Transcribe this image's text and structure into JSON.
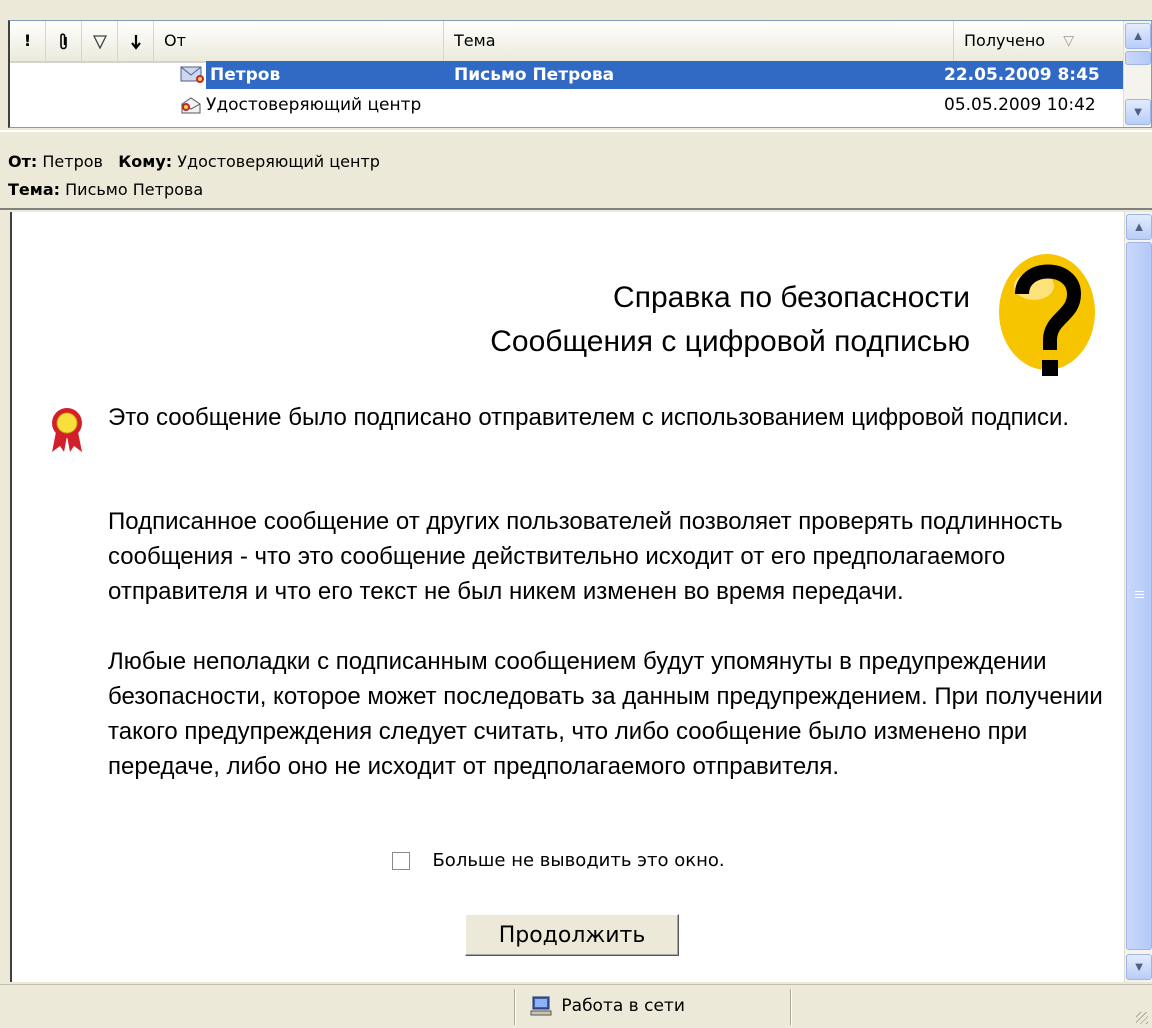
{
  "message_list": {
    "columns": {
      "importance_icon": "exclamation-icon",
      "attachment_icon": "paperclip-icon",
      "flag_icon": "flag-icon",
      "download_icon": "down-arrow-icon",
      "from": "От",
      "subject": "Тема",
      "received": "Получено"
    },
    "rows": [
      {
        "from": "Петров",
        "subject": "Письмо Петрова",
        "received": "22.05.2009 8:45",
        "selected": true,
        "icon": "signed-mail-icon"
      },
      {
        "from": "Удостоверяющий центр",
        "subject": "",
        "received": "05.05.2009 10:42",
        "selected": false,
        "icon": "signed-open-mail-icon"
      }
    ]
  },
  "preview_header": {
    "from_label": "От:",
    "from_value": "Петров",
    "to_label": "Кому:",
    "to_value": "Удостоверяющий центр",
    "subject_label": "Тема:",
    "subject_value": "Письмо Петрова"
  },
  "security_help": {
    "title_line1": "Справка по безопасности",
    "title_line2": "Сообщения с цифровой подписью",
    "para1": "Это сообщение было подписано отправителем с использованием цифровой подписи.",
    "para2": "Подписанное сообщение от других пользователей позволяет проверять подлинность сообщения - что это сообщение действительно исходит от его предполагаемого отправителя и что его текст не был никем изменен во время передачи.",
    "para3": "Любые неполадки с подписанным сообщением будут упомянуты в предупреждении безопасности, которое может последовать за данным предупреждением. При получении такого предупреждения следует считать, что либо сообщение было изменено при передаче, либо оно не исходит от предполагаемого отправителя.",
    "checkbox_label": "Больше не выводить это окно.",
    "checkbox_checked": false,
    "continue_button": "Продолжить"
  },
  "status_bar": {
    "network_status": "Работа в сети"
  },
  "colors": {
    "selection": "#316ac5",
    "scrollbar": "#b9cdf7",
    "window_bg": "#ece9d8"
  }
}
